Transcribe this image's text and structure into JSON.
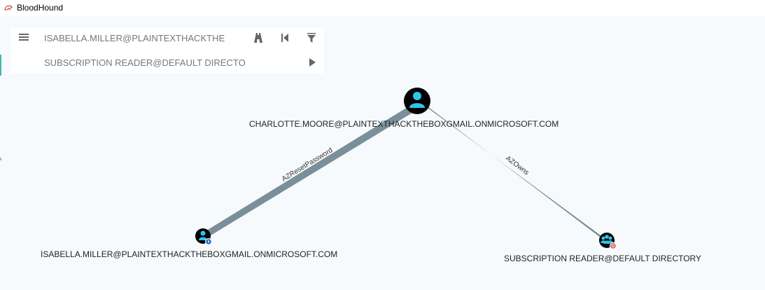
{
  "window": {
    "title": "BloodHound",
    "icon": "bloodhound-logo-icon"
  },
  "search": {
    "start_value": "ISABELLA.MILLER@PLAINTEXTHACKTHE",
    "target_value": "SUBSCRIPTION READER@DEFAULT DIRECTO",
    "icons": [
      "menu-icon",
      "pathfinding-icon",
      "back-icon",
      "filter-icon",
      "play-icon"
    ]
  },
  "graph": {
    "nodes": [
      {
        "id": "charlotte",
        "label": "CHARLOTTE.MOORE@PLAINTEXTHACKTHEBOXGMAIL.ONMICROSOFT.COM",
        "type": "AZUser"
      },
      {
        "id": "isabella",
        "label": "ISABELLA.MILLER@PLAINTEXTHACKTHEBOXGMAIL.ONMICROSOFT.COM",
        "type": "AZUser"
      },
      {
        "id": "subscription",
        "label": "SUBSCRIPTION READER@DEFAULT DIRECTORY",
        "type": "AZGroup"
      }
    ],
    "edges": [
      {
        "from": "charlotte",
        "to": "isabella",
        "label": "AZResetPassword"
      },
      {
        "from": "charlotte",
        "to": "subscription",
        "label": "AZOwns"
      }
    ]
  },
  "colors": {
    "node_fill": "#000000",
    "user_glyph": "#2ec4e8",
    "edge": "#7a8f9a",
    "background": "#f7fafd",
    "owned_badge": "#1b6fd8",
    "target_badge": "#d9534f"
  }
}
